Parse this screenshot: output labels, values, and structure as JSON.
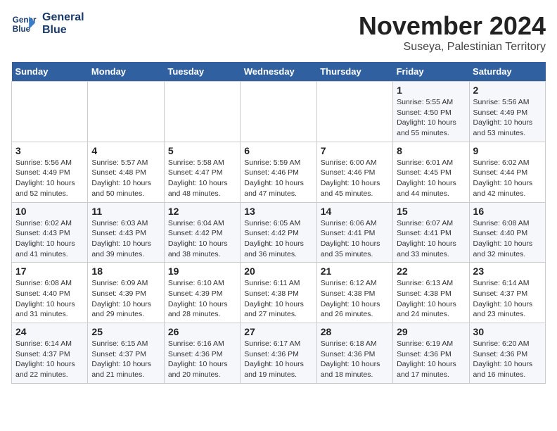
{
  "logo": {
    "line1": "General",
    "line2": "Blue"
  },
  "title": "November 2024",
  "subtitle": "Suseya, Palestinian Territory",
  "headers": [
    "Sunday",
    "Monday",
    "Tuesday",
    "Wednesday",
    "Thursday",
    "Friday",
    "Saturday"
  ],
  "weeks": [
    [
      {
        "day": "",
        "info": ""
      },
      {
        "day": "",
        "info": ""
      },
      {
        "day": "",
        "info": ""
      },
      {
        "day": "",
        "info": ""
      },
      {
        "day": "",
        "info": ""
      },
      {
        "day": "1",
        "info": "Sunrise: 5:55 AM\nSunset: 4:50 PM\nDaylight: 10 hours\nand 55 minutes."
      },
      {
        "day": "2",
        "info": "Sunrise: 5:56 AM\nSunset: 4:49 PM\nDaylight: 10 hours\nand 53 minutes."
      }
    ],
    [
      {
        "day": "3",
        "info": "Sunrise: 5:56 AM\nSunset: 4:49 PM\nDaylight: 10 hours\nand 52 minutes."
      },
      {
        "day": "4",
        "info": "Sunrise: 5:57 AM\nSunset: 4:48 PM\nDaylight: 10 hours\nand 50 minutes."
      },
      {
        "day": "5",
        "info": "Sunrise: 5:58 AM\nSunset: 4:47 PM\nDaylight: 10 hours\nand 48 minutes."
      },
      {
        "day": "6",
        "info": "Sunrise: 5:59 AM\nSunset: 4:46 PM\nDaylight: 10 hours\nand 47 minutes."
      },
      {
        "day": "7",
        "info": "Sunrise: 6:00 AM\nSunset: 4:46 PM\nDaylight: 10 hours\nand 45 minutes."
      },
      {
        "day": "8",
        "info": "Sunrise: 6:01 AM\nSunset: 4:45 PM\nDaylight: 10 hours\nand 44 minutes."
      },
      {
        "day": "9",
        "info": "Sunrise: 6:02 AM\nSunset: 4:44 PM\nDaylight: 10 hours\nand 42 minutes."
      }
    ],
    [
      {
        "day": "10",
        "info": "Sunrise: 6:02 AM\nSunset: 4:43 PM\nDaylight: 10 hours\nand 41 minutes."
      },
      {
        "day": "11",
        "info": "Sunrise: 6:03 AM\nSunset: 4:43 PM\nDaylight: 10 hours\nand 39 minutes."
      },
      {
        "day": "12",
        "info": "Sunrise: 6:04 AM\nSunset: 4:42 PM\nDaylight: 10 hours\nand 38 minutes."
      },
      {
        "day": "13",
        "info": "Sunrise: 6:05 AM\nSunset: 4:42 PM\nDaylight: 10 hours\nand 36 minutes."
      },
      {
        "day": "14",
        "info": "Sunrise: 6:06 AM\nSunset: 4:41 PM\nDaylight: 10 hours\nand 35 minutes."
      },
      {
        "day": "15",
        "info": "Sunrise: 6:07 AM\nSunset: 4:41 PM\nDaylight: 10 hours\nand 33 minutes."
      },
      {
        "day": "16",
        "info": "Sunrise: 6:08 AM\nSunset: 4:40 PM\nDaylight: 10 hours\nand 32 minutes."
      }
    ],
    [
      {
        "day": "17",
        "info": "Sunrise: 6:08 AM\nSunset: 4:40 PM\nDaylight: 10 hours\nand 31 minutes."
      },
      {
        "day": "18",
        "info": "Sunrise: 6:09 AM\nSunset: 4:39 PM\nDaylight: 10 hours\nand 29 minutes."
      },
      {
        "day": "19",
        "info": "Sunrise: 6:10 AM\nSunset: 4:39 PM\nDaylight: 10 hours\nand 28 minutes."
      },
      {
        "day": "20",
        "info": "Sunrise: 6:11 AM\nSunset: 4:38 PM\nDaylight: 10 hours\nand 27 minutes."
      },
      {
        "day": "21",
        "info": "Sunrise: 6:12 AM\nSunset: 4:38 PM\nDaylight: 10 hours\nand 26 minutes."
      },
      {
        "day": "22",
        "info": "Sunrise: 6:13 AM\nSunset: 4:38 PM\nDaylight: 10 hours\nand 24 minutes."
      },
      {
        "day": "23",
        "info": "Sunrise: 6:14 AM\nSunset: 4:37 PM\nDaylight: 10 hours\nand 23 minutes."
      }
    ],
    [
      {
        "day": "24",
        "info": "Sunrise: 6:14 AM\nSunset: 4:37 PM\nDaylight: 10 hours\nand 22 minutes."
      },
      {
        "day": "25",
        "info": "Sunrise: 6:15 AM\nSunset: 4:37 PM\nDaylight: 10 hours\nand 21 minutes."
      },
      {
        "day": "26",
        "info": "Sunrise: 6:16 AM\nSunset: 4:36 PM\nDaylight: 10 hours\nand 20 minutes."
      },
      {
        "day": "27",
        "info": "Sunrise: 6:17 AM\nSunset: 4:36 PM\nDaylight: 10 hours\nand 19 minutes."
      },
      {
        "day": "28",
        "info": "Sunrise: 6:18 AM\nSunset: 4:36 PM\nDaylight: 10 hours\nand 18 minutes."
      },
      {
        "day": "29",
        "info": "Sunrise: 6:19 AM\nSunset: 4:36 PM\nDaylight: 10 hours\nand 17 minutes."
      },
      {
        "day": "30",
        "info": "Sunrise: 6:20 AM\nSunset: 4:36 PM\nDaylight: 10 hours\nand 16 minutes."
      }
    ]
  ]
}
